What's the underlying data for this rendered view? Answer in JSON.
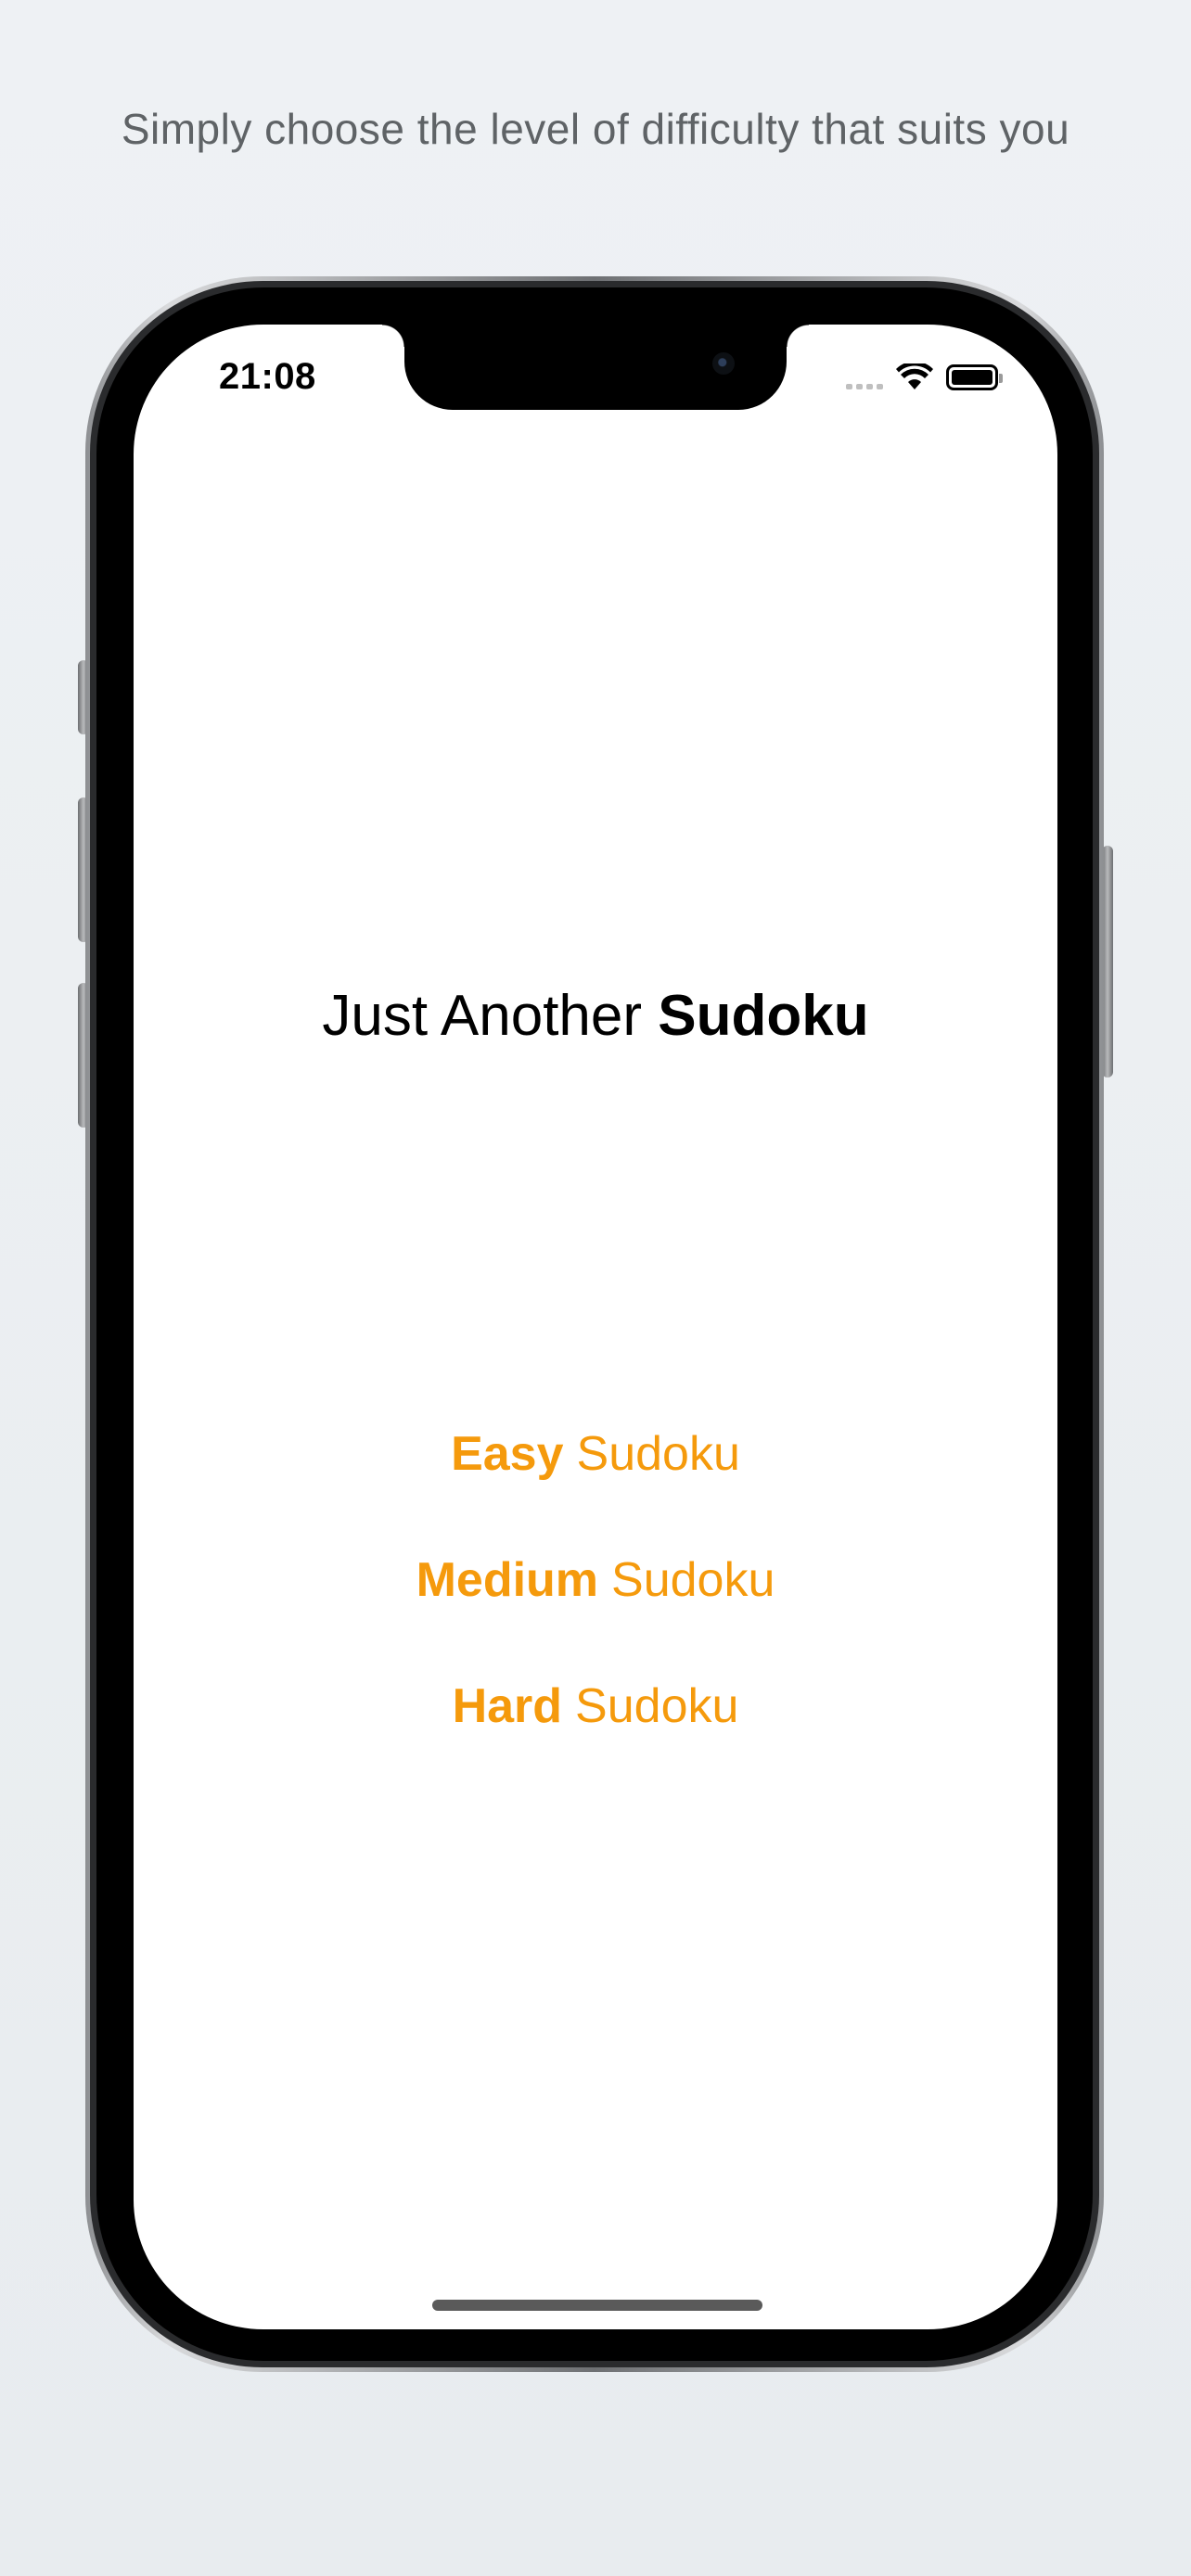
{
  "caption": "Simply choose the level of difficulty that suits you",
  "status_bar": {
    "time": "21:08",
    "icons": [
      "cellular-signal-icon",
      "wifi-icon",
      "battery-icon"
    ]
  },
  "app": {
    "title_regular": "Just Another",
    "title_bold": "Sudoku"
  },
  "menu": {
    "items": [
      {
        "level": "Easy",
        "suffix": "Sudoku"
      },
      {
        "level": "Medium",
        "suffix": "Sudoku"
      },
      {
        "level": "Hard",
        "suffix": "Sudoku"
      }
    ]
  },
  "colors": {
    "accent": "#F59A0C",
    "background": "#EEF1F4",
    "screen": "#FFFFFF"
  }
}
